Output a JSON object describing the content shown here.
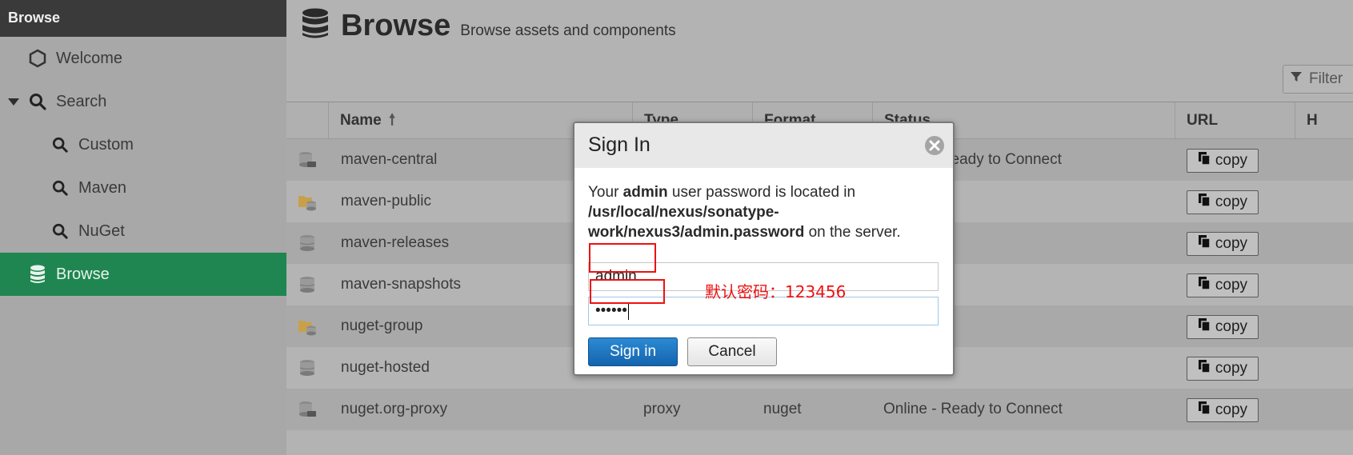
{
  "sidebar": {
    "header": "Browse",
    "items": [
      {
        "label": "Welcome",
        "icon": "hexagon-icon"
      },
      {
        "label": "Search",
        "icon": "search-icon"
      },
      {
        "label": "Custom",
        "icon": "search-icon"
      },
      {
        "label": "Maven",
        "icon": "search-icon"
      },
      {
        "label": "NuGet",
        "icon": "search-icon"
      },
      {
        "label": "Browse",
        "icon": "database-icon",
        "active": true
      }
    ]
  },
  "page": {
    "title": "Browse",
    "subtitle": "Browse assets and components",
    "filter_placeholder": "Filter"
  },
  "grid": {
    "columns": [
      "Name",
      "Type",
      "Format",
      "Status",
      "URL",
      "H"
    ],
    "copy_label": "copy",
    "rows": [
      {
        "name": "maven-central",
        "type": "",
        "format": "",
        "status": "Online - Ready to Connect",
        "icon": "proxy-repo-icon"
      },
      {
        "name": "maven-public",
        "type": "",
        "format": "",
        "status": "",
        "icon": "group-repo-icon"
      },
      {
        "name": "maven-releases",
        "type": "",
        "format": "",
        "status": "",
        "icon": "hosted-repo-icon"
      },
      {
        "name": "maven-snapshots",
        "type": "",
        "format": "",
        "status": "",
        "icon": "hosted-repo-icon"
      },
      {
        "name": "nuget-group",
        "type": "",
        "format": "",
        "status": "",
        "icon": "group-repo-icon"
      },
      {
        "name": "nuget-hosted",
        "type": "",
        "format": "",
        "status": "",
        "icon": "hosted-repo-icon"
      },
      {
        "name": "nuget.org-proxy",
        "type": "proxy",
        "format": "nuget",
        "status": "Online - Ready to Connect",
        "icon": "proxy-repo-icon"
      }
    ]
  },
  "modal": {
    "title": "Sign In",
    "text_prefix": "Your ",
    "text_user": "admin",
    "text_mid": " user password is located in ",
    "text_path": "/usr/local/nexus/sonatype-work/nexus3/admin.password",
    "text_suffix": " on the server.",
    "username_value": "admin",
    "password_mask": "••••••",
    "annotation": "默认密码：123456",
    "sign_in_label": "Sign in",
    "cancel_label": "Cancel"
  },
  "colors": {
    "active_nav": "#1f8651",
    "primary_button": "#1a6fbd",
    "annotation": "#e11111"
  }
}
